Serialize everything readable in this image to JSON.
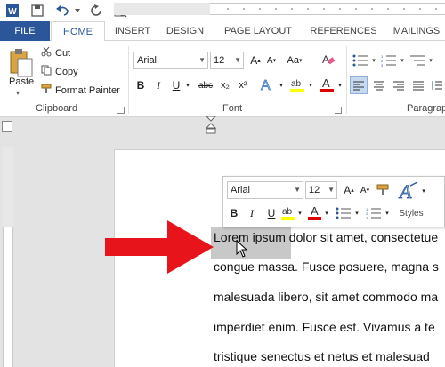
{
  "quick_access": {
    "icons": [
      "word-logo-icon",
      "save-icon",
      "undo-icon",
      "redo-icon",
      "print-preview-icon"
    ]
  },
  "tabs": [
    {
      "label": "FILE"
    },
    {
      "label": "HOME"
    },
    {
      "label": "INSERT"
    },
    {
      "label": "DESIGN"
    },
    {
      "label": "PAGE LAYOUT"
    },
    {
      "label": "REFERENCES"
    },
    {
      "label": "MAILINGS"
    }
  ],
  "clipboard": {
    "paste_label": "Paste",
    "cut_label": "Cut",
    "copy_label": "Copy",
    "format_painter_label": "Format Painter",
    "group_label": "Clipboard"
  },
  "font": {
    "font_name": "Arial",
    "font_size": "12",
    "group_label": "Font",
    "bold": "B",
    "italic": "I",
    "underline": "U",
    "strike": "abc",
    "subscript": "x₂",
    "superscript": "x²",
    "grow": "A",
    "shrink": "A",
    "change_case": "Aa"
  },
  "paragraph": {
    "group_label": "Paragrap"
  },
  "mini_toolbar": {
    "font_name": "Arial",
    "font_size": "12",
    "bold": "B",
    "italic": "I",
    "styles_label": "Styles"
  },
  "document": {
    "lines": [
      "Lorem ipsum dolor sit amet, consectetue",
      "congue massa. Fusce posuere, magna s",
      "malesuada libero, sit amet commodo ma",
      "imperdiet enim. Fusce est. Vivamus a te",
      "tristique senectus et netus et malesuad"
    ]
  },
  "colors": {
    "accent": "#2b579a",
    "highlight": "#ffff00",
    "font_color": "#e00000",
    "arrow": "#e8141c"
  }
}
